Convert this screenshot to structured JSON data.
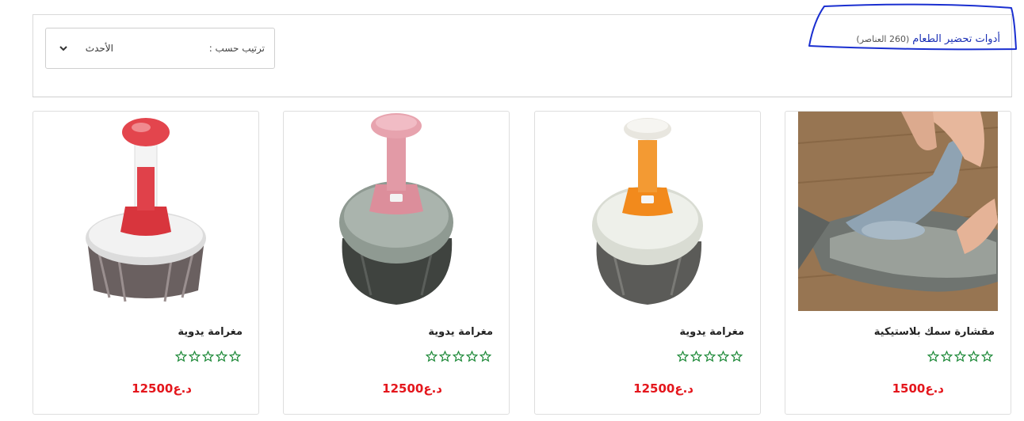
{
  "header": {
    "category_title": "أدوات تحضير الطعام",
    "item_count": "(260 العناصر)",
    "sort_label": "ترتيب حسب :",
    "sort_value": "الأحدث"
  },
  "products": [
    {
      "name": "مغرامة يدوية",
      "price": "12500د.ع",
      "rating": 0
    },
    {
      "name": "مغرامة يدوية",
      "price": "12500د.ع",
      "rating": 0
    },
    {
      "name": "مغرامة يدوية",
      "price": "12500د.ع",
      "rating": 0
    },
    {
      "name": "مقشارة سمك بلاستيكية",
      "price": "1500د.ع",
      "rating": 0
    }
  ],
  "colors": {
    "price": "#e4161c",
    "star": "#1f8a3a",
    "category_link": "#1a2fb5",
    "annotation": "#1a2fd0"
  }
}
